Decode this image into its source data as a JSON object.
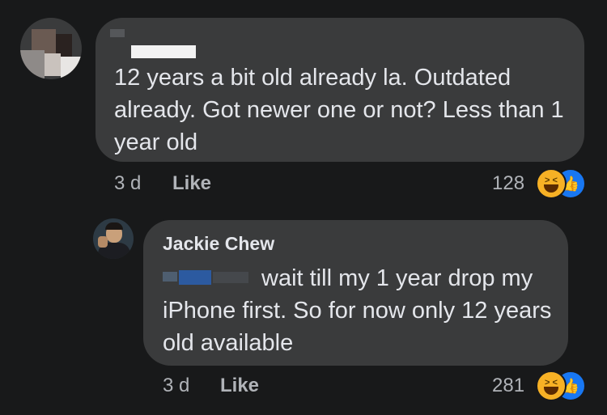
{
  "comment": {
    "text": "12 years a bit old already la. Outdated already. Got newer one or not? Less than 1 year old",
    "time": "3 d",
    "like_label": "Like",
    "reaction_count": "128"
  },
  "reply": {
    "author": "Jackie Chew",
    "text": "wait till my 1 year drop my iPhone first. So for now only 12 years old available",
    "time": "3 d",
    "like_label": "Like",
    "reaction_count": "281"
  },
  "reactions": {
    "icons": [
      "haha-icon",
      "like-icon"
    ],
    "colors": {
      "haha": "#f7b125",
      "like": "#1877f2"
    }
  },
  "theme": {
    "background": "#18191a",
    "bubble": "#3a3b3c",
    "text": "#e4e6eb",
    "meta": "#b0b3b8"
  }
}
